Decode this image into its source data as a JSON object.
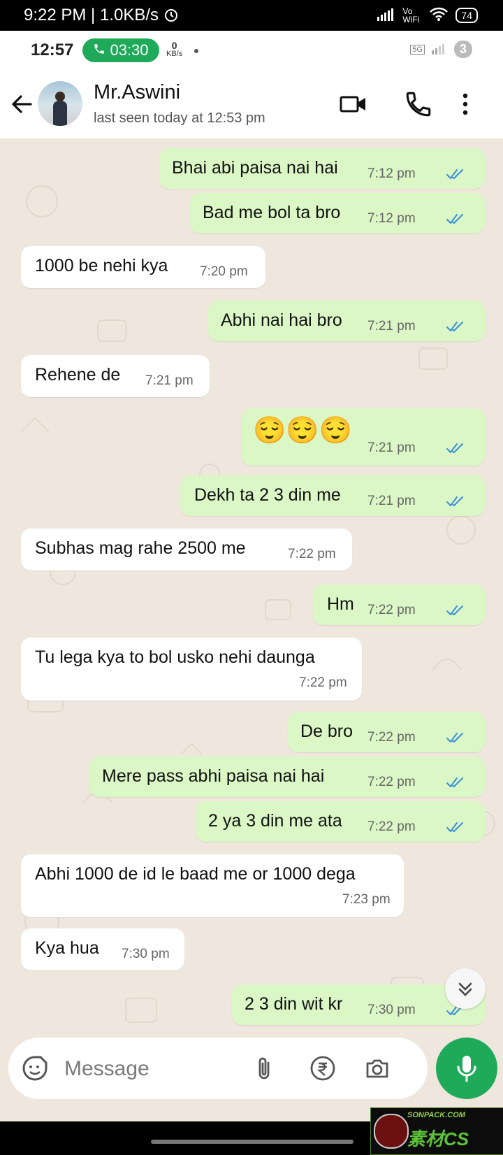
{
  "device_status": {
    "time": "9:22 PM",
    "speed": "1.0KB/s",
    "network": "Vo WiFi",
    "battery": "74"
  },
  "inner_status": {
    "time": "12:57",
    "call_timer": "03:30",
    "kbs_value": "0",
    "kbs_unit": "KB/s",
    "network": "5G",
    "badge": "3"
  },
  "contact": {
    "name": "Mr.Aswini",
    "last_seen": "last seen today at 12:53 pm"
  },
  "messages": [
    {
      "dir": "out",
      "text": "Bhai abi paisa nai hai",
      "time": "7:12 pm"
    },
    {
      "dir": "out",
      "text": "Bad me bol ta bro",
      "time": "7:12 pm"
    },
    {
      "dir": "in",
      "text": "1000 be nehi kya",
      "time": "7:20 pm"
    },
    {
      "dir": "out",
      "text": "Abhi nai hai bro",
      "time": "7:21 pm"
    },
    {
      "dir": "in",
      "text": "Rehene de",
      "time": "7:21 pm"
    },
    {
      "dir": "out",
      "text": "😌😌😌",
      "time": "7:21 pm"
    },
    {
      "dir": "out",
      "text": "Dekh ta 2 3 din me",
      "time": "7:21 pm"
    },
    {
      "dir": "in",
      "text": "Subhas mag rahe 2500 me",
      "time": "7:22 pm"
    },
    {
      "dir": "out",
      "text": "Hm",
      "time": "7:22 pm"
    },
    {
      "dir": "in",
      "text": "Tu lega kya to bol usko nehi daunga",
      "time": "7:22 pm"
    },
    {
      "dir": "out",
      "text": "De bro",
      "time": "7:22 pm"
    },
    {
      "dir": "out",
      "text": "Mere pass abhi paisa  nai hai",
      "time": "7:22 pm"
    },
    {
      "dir": "out",
      "text": "2 ya 3 din me ata",
      "time": "7:22 pm"
    },
    {
      "dir": "in",
      "text": "Abhi 1000 de id le baad me or 1000 dega",
      "time": "7:23 pm"
    },
    {
      "dir": "in",
      "text": "Kya hua",
      "time": "7:30 pm"
    },
    {
      "dir": "out",
      "text": "2 3 din wit kr",
      "time": "7:30 pm"
    }
  ],
  "composer": {
    "placeholder": "Message"
  },
  "watermark": {
    "line1": "SONPACK.COM",
    "line2": "素材CS"
  },
  "colors": {
    "outgoing": "#dbf7c6",
    "incoming": "#ffffff",
    "accent": "#1faa59",
    "ticks": "#3a8fd8",
    "chat_bg": "#efe7dd"
  },
  "icons": [
    "back-arrow-icon",
    "video-call-icon",
    "phone-icon",
    "more-vert-icon",
    "sticker-icon",
    "attach-icon",
    "rupee-icon",
    "camera-icon",
    "mic-icon",
    "chevron-down-icon",
    "call-icon",
    "alarm-icon",
    "wifi-icon",
    "signal-icon"
  ]
}
